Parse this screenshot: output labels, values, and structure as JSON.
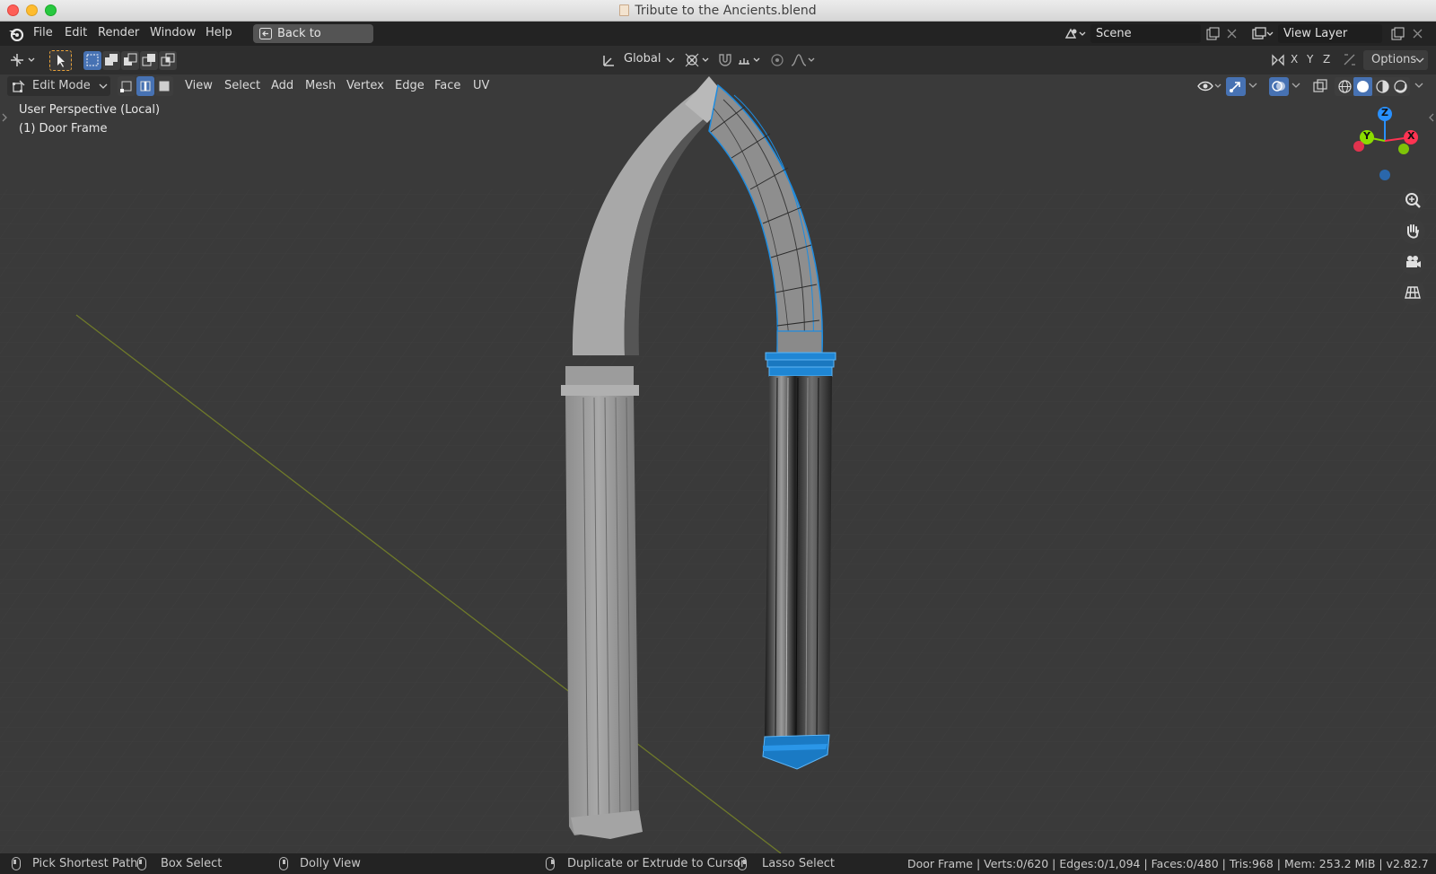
{
  "window": {
    "title": "Tribute to the Ancients.blend"
  },
  "topbar": {
    "menus": [
      "File",
      "Edit",
      "Render",
      "Window",
      "Help"
    ],
    "back_button": "Back to Previous",
    "scene_field": "Scene",
    "view_layer_field": "View Layer"
  },
  "header": {
    "transform_orientation": "Global",
    "axis_x": "X",
    "axis_y": "Y",
    "axis_z": "Z",
    "options_label": "Options",
    "mode": "Edit Mode",
    "edit_menus": [
      "View",
      "Select",
      "Add",
      "Mesh",
      "Vertex",
      "Edge",
      "Face",
      "UV"
    ]
  },
  "viewport": {
    "perspective_label": "User Perspective (Local)",
    "object_label": "(1) Door Frame",
    "gizmo": {
      "z": "Z",
      "y": "Y",
      "x": "X"
    }
  },
  "statusbar": {
    "pick_shortest_path": "Pick Shortest Path",
    "box_select": "Box Select",
    "dolly_view": "Dolly View",
    "duplicate_extrude": "Duplicate or Extrude to Cursor",
    "lasso_select": "Lasso Select",
    "stats": "Door Frame | Verts:0/620 | Edges:0/1,094 | Faces:0/480 | Tris:968 | Mem: 253.2 MiB | v2.82.7"
  },
  "colors": {
    "selection_blue": "#1d8ce0",
    "active_button": "#4772b3",
    "axis_x": "#ff3352",
    "axis_y": "#8bdc00",
    "axis_z": "#2890ff"
  }
}
